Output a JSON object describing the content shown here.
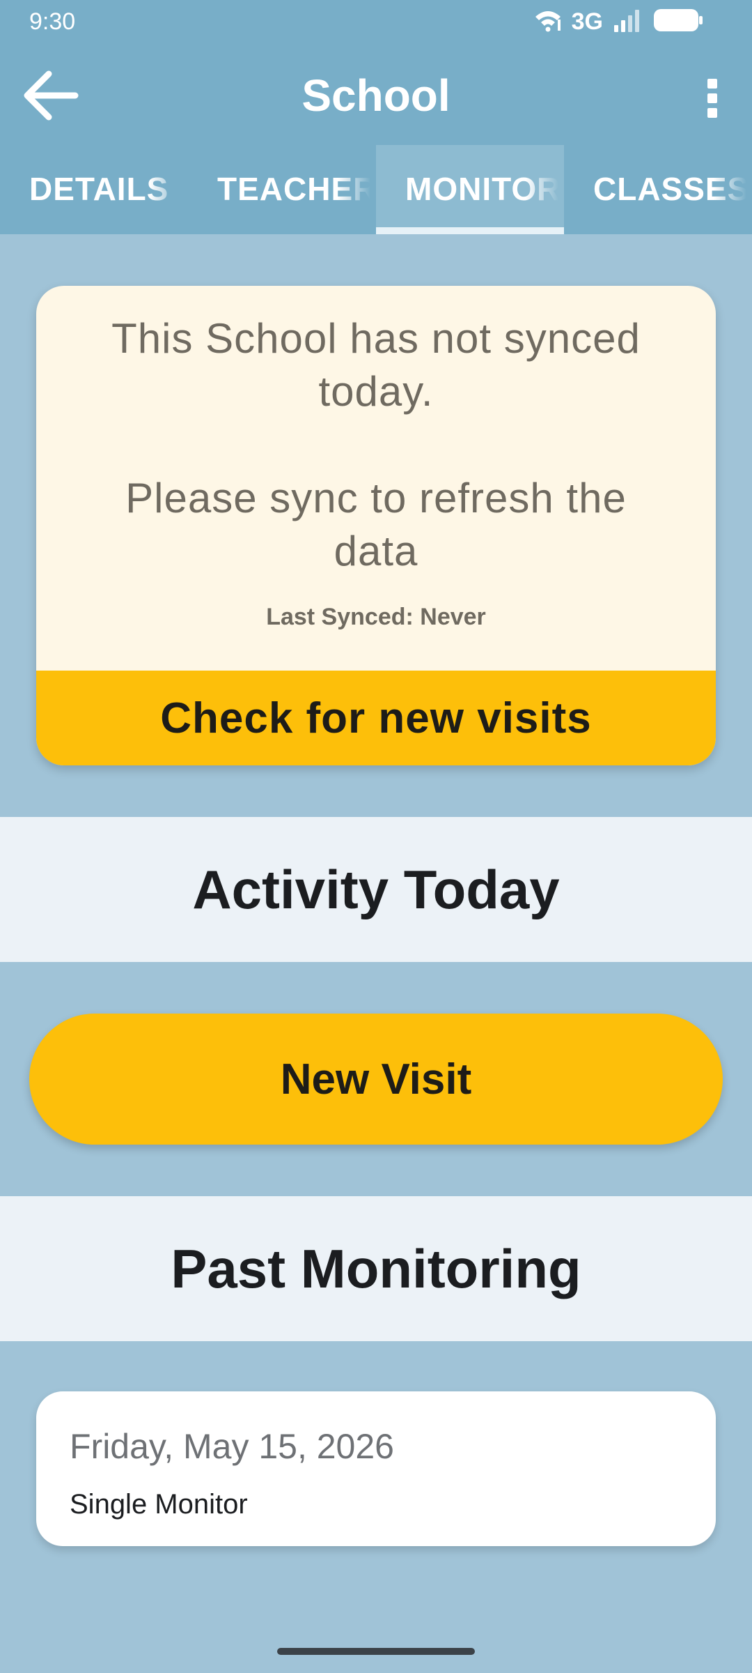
{
  "status_bar": {
    "time": "9:30",
    "network": "3G"
  },
  "app_bar": {
    "title": "School"
  },
  "tabs": [
    {
      "label": "DETAILS",
      "active": false
    },
    {
      "label": "TEACHERS",
      "active": false
    },
    {
      "label": "MONITORING",
      "active": true
    },
    {
      "label": "CLASSES",
      "active": false
    }
  ],
  "sync_card": {
    "message_line1": "This School has not synced today.",
    "message_line2": "Please sync to refresh the data",
    "last_synced": "Last Synced: Never",
    "button_label": "Check for new visits"
  },
  "activity_section": {
    "title": "Activity Today",
    "new_visit_label": "New Visit"
  },
  "past_section": {
    "title": "Past Monitoring",
    "visits": [
      {
        "date": "Friday, May 15, 2026",
        "type": "Single Monitor"
      }
    ]
  },
  "colors": {
    "app_bar": "#78aec8",
    "background": "#a0c3d7",
    "accent_button": "#fdbf0a",
    "sync_card": "#fef7e6",
    "section_header": "#ecf2f7"
  },
  "icons": {
    "back": "arrow-left-icon",
    "menu": "more-vert-icon",
    "wifi": "wifi-icon",
    "signal": "cell-signal-icon",
    "battery": "battery-icon"
  }
}
